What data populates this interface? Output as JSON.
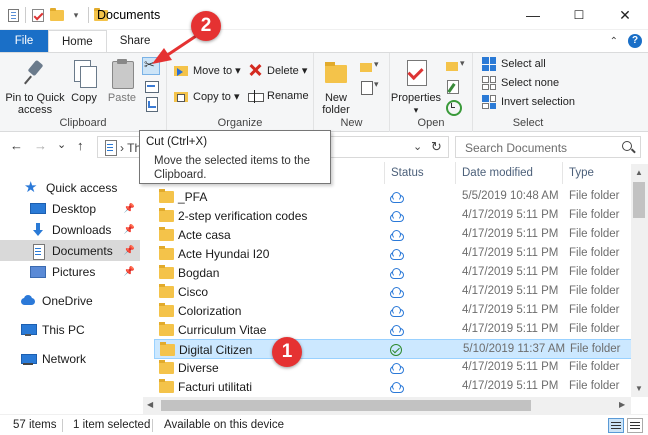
{
  "window": {
    "title": "Documents",
    "minimize_glyph": "—",
    "maximize_glyph": "☐",
    "close_glyph": "✕"
  },
  "ribbon_tabs": [
    {
      "label": "File",
      "active": false
    },
    {
      "label": "Home",
      "active": true
    },
    {
      "label": "Share",
      "active": false
    }
  ],
  "ribbon": {
    "clipboard": {
      "label": "Clipboard",
      "pin_label_1": "Pin to Quick",
      "pin_label_2": "access",
      "copy": "Copy",
      "paste": "Paste"
    },
    "organize": {
      "label": "Organize",
      "move_to": "Move to ▾",
      "copy_to": "Copy to ▾",
      "delete": "Delete ▾",
      "rename": "Rename"
    },
    "new": {
      "label": "New",
      "new_folder_1": "New",
      "new_folder_2": "folder"
    },
    "open": {
      "label": "Open",
      "properties": "Properties",
      "properties_arrow": "▾"
    },
    "select": {
      "label": "Select",
      "select_all": "Select all",
      "select_none": "Select none",
      "invert_selection": "Invert selection"
    }
  },
  "navbar": {
    "back": "←",
    "forward": "→",
    "recent": "⌄",
    "up": "↑",
    "address_prefix": "› Th",
    "address_dropdown": "⌄",
    "refresh": "↻",
    "search_placeholder": "Search Documents"
  },
  "tooltip": {
    "title": "Cut (Ctrl+X)",
    "body": "Move the selected items to the Clipboard."
  },
  "nav_pane": [
    {
      "label": "Quick access",
      "icon": "star-icon",
      "pinned": false,
      "selected": false
    },
    {
      "label": "Desktop",
      "icon": "desktop-icon",
      "pinned": true,
      "selected": false
    },
    {
      "label": "Downloads",
      "icon": "download-icon",
      "pinned": true,
      "selected": false
    },
    {
      "label": "Documents",
      "icon": "documents-icon",
      "pinned": true,
      "selected": true
    },
    {
      "label": "Pictures",
      "icon": "pictures-icon",
      "pinned": true,
      "selected": false
    },
    {
      "label": "OneDrive",
      "icon": "onedrive-icon",
      "pinned": false,
      "selected": false
    },
    {
      "label": "This PC",
      "icon": "computer-icon",
      "pinned": false,
      "selected": false
    },
    {
      "label": "Network",
      "icon": "network-icon",
      "pinned": false,
      "selected": false
    }
  ],
  "columns": {
    "status": "Status",
    "date_modified": "Date modified",
    "type": "Type"
  },
  "files": [
    {
      "name": "_PFA",
      "status": "cloud",
      "date": "5/5/2019 10:48 AM",
      "type": "File folder",
      "selected": false
    },
    {
      "name": "2-step verification codes",
      "status": "cloud",
      "date": "4/17/2019 5:11 PM",
      "type": "File folder",
      "selected": false
    },
    {
      "name": "Acte casa",
      "status": "cloud",
      "date": "4/17/2019 5:11 PM",
      "type": "File folder",
      "selected": false
    },
    {
      "name": "Acte Hyundai I20",
      "status": "cloud",
      "date": "4/17/2019 5:11 PM",
      "type": "File folder",
      "selected": false
    },
    {
      "name": "Bogdan",
      "status": "cloud",
      "date": "4/17/2019 5:11 PM",
      "type": "File folder",
      "selected": false
    },
    {
      "name": "Cisco",
      "status": "cloud",
      "date": "4/17/2019 5:11 PM",
      "type": "File folder",
      "selected": false
    },
    {
      "name": "Colorization",
      "status": "cloud",
      "date": "4/17/2019 5:11 PM",
      "type": "File folder",
      "selected": false
    },
    {
      "name": "Curriculum Vitae",
      "status": "cloud",
      "date": "4/17/2019 5:11 PM",
      "type": "File folder",
      "selected": false
    },
    {
      "name": "Digital Citizen",
      "status": "check",
      "date": "5/10/2019 11:37 AM",
      "type": "File folder",
      "selected": true
    },
    {
      "name": "Diverse",
      "status": "cloud",
      "date": "4/17/2019 5:11 PM",
      "type": "File folder",
      "selected": false
    },
    {
      "name": "Facturi utilitati",
      "status": "cloud",
      "date": "4/17/2019 5:11 PM",
      "type": "File folder",
      "selected": false
    }
  ],
  "statusbar": {
    "item_count": "57 items",
    "selection": "1 item selected",
    "availability": "Available on this device"
  },
  "annotations": [
    {
      "label": "1"
    },
    {
      "label": "2"
    }
  ],
  "colors": {
    "accent": "#1a6fc7",
    "selection": "#cce8ff",
    "annotation": "#e53232",
    "folder": "#f4c34a"
  }
}
